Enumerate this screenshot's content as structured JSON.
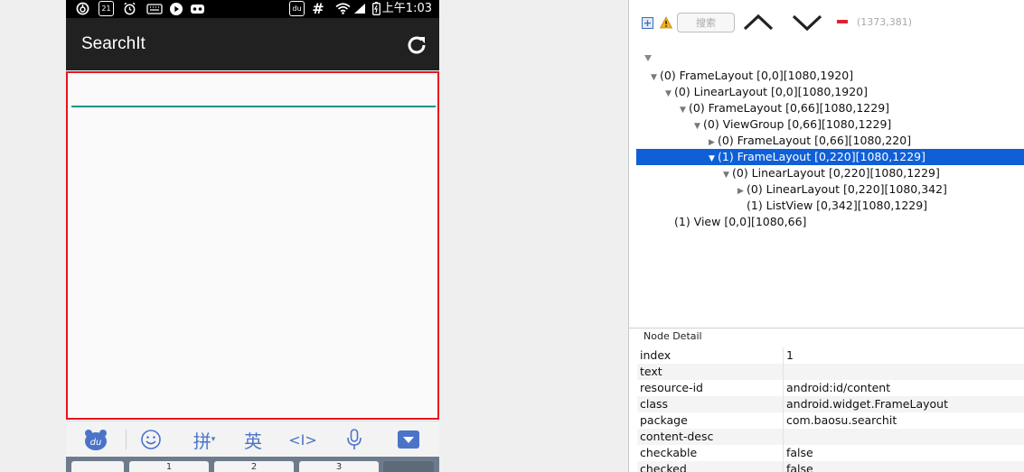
{
  "phone": {
    "status_time": "上午1:03",
    "status_badges": {
      "calendar_day": "21",
      "du": "du"
    },
    "app_title": "SearchIt",
    "keyboard": {
      "pinyin_label": "拼",
      "english_label": "英",
      "cursor_label": "<I>",
      "keys": [
        "1",
        "2",
        "3"
      ]
    }
  },
  "inspector": {
    "search_placeholder": "搜索",
    "coords": "(1373,381)",
    "tree": [
      {
        "indent": 1,
        "expanded": true,
        "has_children": true,
        "label": "(0) FrameLayout [0,0][1080,1920]"
      },
      {
        "indent": 2,
        "expanded": true,
        "has_children": true,
        "label": "(0) LinearLayout [0,0][1080,1920]"
      },
      {
        "indent": 3,
        "expanded": true,
        "has_children": true,
        "label": "(0) FrameLayout [0,66][1080,1229]"
      },
      {
        "indent": 4,
        "expanded": true,
        "has_children": true,
        "label": "(0) ViewGroup [0,66][1080,1229]"
      },
      {
        "indent": 5,
        "expanded": false,
        "has_children": true,
        "label": "(0) FrameLayout [0,66][1080,220]"
      },
      {
        "indent": 5,
        "expanded": true,
        "has_children": true,
        "selected": true,
        "label": "(1) FrameLayout [0,220][1080,1229]"
      },
      {
        "indent": 6,
        "expanded": true,
        "has_children": true,
        "label": "(0) LinearLayout [0,220][1080,1229]"
      },
      {
        "indent": 7,
        "expanded": false,
        "has_children": true,
        "label": "(0) LinearLayout [0,220][1080,342]"
      },
      {
        "indent": 7,
        "expanded": false,
        "has_children": false,
        "label": "(1) ListView [0,342][1080,1229]"
      },
      {
        "indent": 2,
        "expanded": false,
        "has_children": false,
        "label": "(1) View [0,0][1080,66]"
      }
    ],
    "node_detail": {
      "title": "Node Detail",
      "rows": [
        {
          "key": "index",
          "value": "1"
        },
        {
          "key": "text",
          "value": ""
        },
        {
          "key": "resource-id",
          "value": "android:id/content"
        },
        {
          "key": "class",
          "value": "android.widget.FrameLayout"
        },
        {
          "key": "package",
          "value": "com.baosu.searchit"
        },
        {
          "key": "content-desc",
          "value": ""
        },
        {
          "key": "checkable",
          "value": "false"
        },
        {
          "key": "checked",
          "value": "false"
        }
      ]
    }
  },
  "colors": {
    "selection": "#0f5fd7",
    "highlight_border": "#e8141c",
    "accent_underline": "#00968a",
    "appbar": "#212121"
  }
}
